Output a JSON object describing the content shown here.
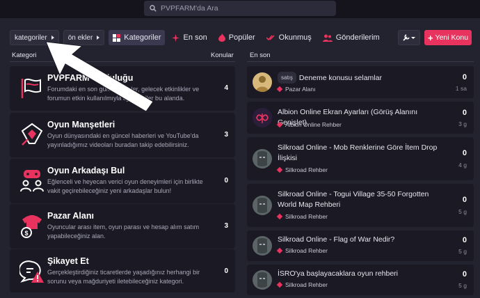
{
  "search": {
    "placeholder": "PVPFARM'da Ara"
  },
  "nav": {
    "crumbs": [
      "kategoriler",
      "ön ekler"
    ],
    "items": [
      {
        "label": "Kategoriler",
        "icon": "grid-icon",
        "active": true
      },
      {
        "label": "En son",
        "icon": "sparkle-icon",
        "active": false
      },
      {
        "label": "Popüler",
        "icon": "flame-icon",
        "active": false
      },
      {
        "label": "Okunmuş",
        "icon": "check-double-icon",
        "active": false
      },
      {
        "label": "Gönderilerim",
        "icon": "user-group-icon",
        "active": false
      }
    ],
    "new_topic_label": "Yeni Konu"
  },
  "columns": {
    "category": "Kategori",
    "topics": "Konular",
    "latest": "En son"
  },
  "categories": [
    {
      "title": "PVPFARM Topluluğu",
      "desc": "Forumdaki en son güncellemeler, gelecek etkinlikler ve forumun etkin kullanılmıyla ilgili bilgiler bu alanda.",
      "count": "4",
      "icon": "flag-icon"
    },
    {
      "title": "Oyun Manşetleri",
      "desc": "Oyun dünyasındaki en güncel haberleri ve YouTube'da yayınladığımız videoları buradan takip edebilirsiniz.",
      "count": "3",
      "icon": "pen-nib-icon"
    },
    {
      "title": "Oyun Arkadaşı Bul",
      "desc": "Eğlenceli ve heyecan verici oyun deneyimleri için birlikte vakit geçirebileceğiniz yeni arkadaşlar bulun!",
      "count": "0",
      "icon": "gamepad-users-icon"
    },
    {
      "title": "Pazar Alanı",
      "desc": "Oyuncular arası item, oyun parası ve hesap alım satım yapabileceğiniz alan.",
      "count": "3",
      "icon": "armor-coin-icon"
    },
    {
      "title": "Şikayet Et",
      "desc": "Gerçekleştirdiğiniz ticaretlerde yaşadığınız herhangi bir sorunu veya mağduriyeti iletebileceğiniz kategori.",
      "count": "0",
      "icon": "alert-chat-icon"
    }
  ],
  "topics": [
    {
      "tag": "satış",
      "title": "Deneme konusu selamlar",
      "category": "Pazar Alanı",
      "replies": "0",
      "age": "1 sa",
      "avatar": "golden-avatar"
    },
    {
      "tag": "",
      "title": "Albion Online Ekran Ayarları (Görüş Alanını Genişlet)",
      "category": "Albion Online Rehber",
      "replies": "0",
      "age": "3 g",
      "avatar": "albion-logo"
    },
    {
      "tag": "",
      "title": "Silkroad Online - Mob Renklerine Göre İtem Drop İlişkisi",
      "category": "Silkroad Rehber",
      "replies": "0",
      "age": "4 g",
      "avatar": "helmet-avatar"
    },
    {
      "tag": "",
      "title": "Silkroad Online - Togui Village 35-50 Forgotten World Map Rehberi",
      "category": "Silkroad Rehber",
      "replies": "0",
      "age": "5 g",
      "avatar": "helmet-avatar"
    },
    {
      "tag": "",
      "title": "Silkroad Online - Flag of War Nedir?",
      "category": "Silkroad Rehber",
      "replies": "0",
      "age": "5 g",
      "avatar": "helmet-avatar"
    },
    {
      "tag": "",
      "title": "İSRO'ya başlayacaklara oyun rehberi",
      "category": "Silkroad Rehber",
      "replies": "0",
      "age": "5 g",
      "avatar": "helmet-avatar"
    }
  ],
  "colors": {
    "accent": "#e8335e",
    "background": "#23222f",
    "card": "#1b1a24"
  }
}
